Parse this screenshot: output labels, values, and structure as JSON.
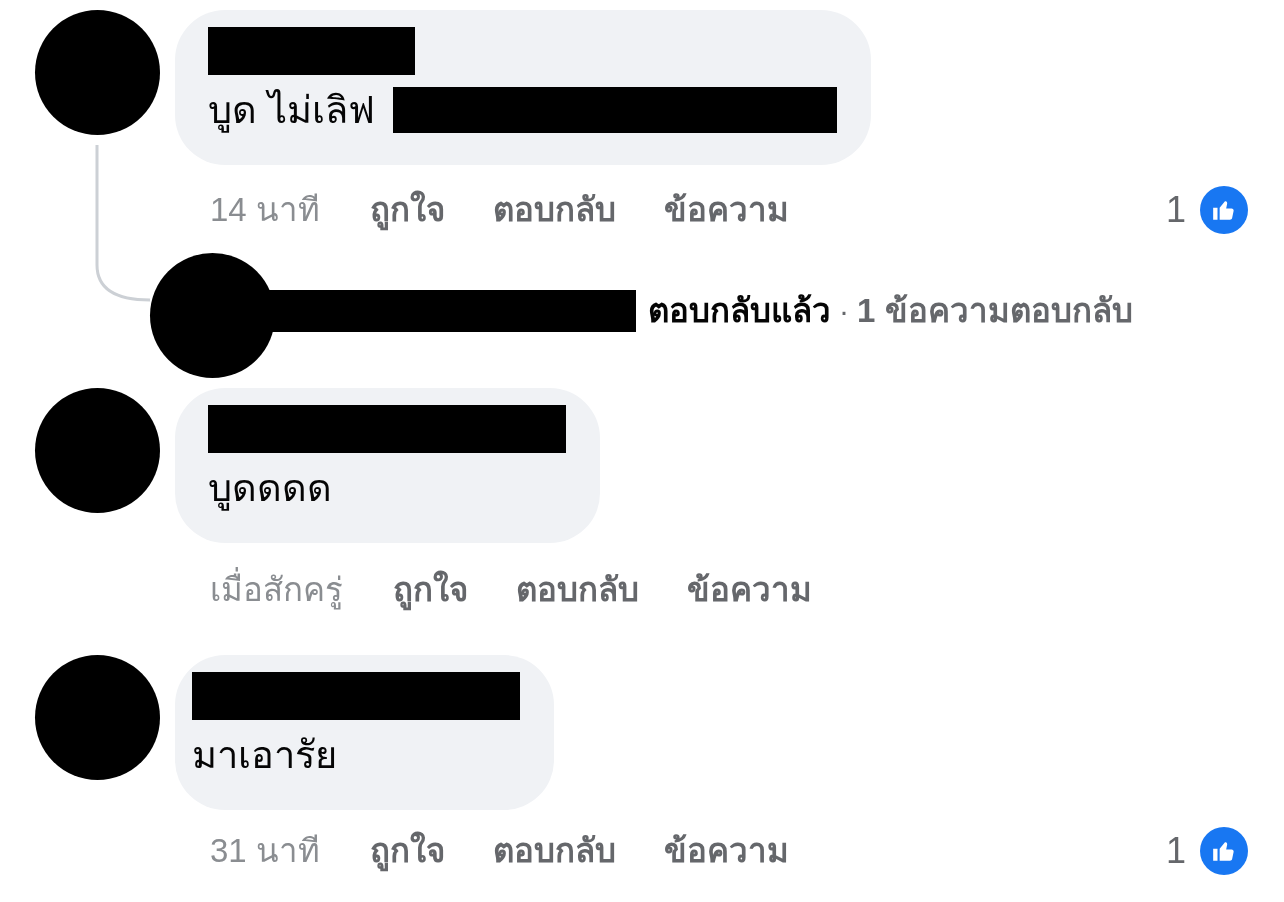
{
  "comments": [
    {
      "text": "บูด ไม่เลิฟ",
      "text_redacted_tail": true,
      "time": "14 นาที",
      "actions": [
        "ถูกใจ",
        "ตอบกลับ",
        "ข้อความ"
      ],
      "like_count": "1",
      "replies": {
        "status": "ตอบกลับแล้ว",
        "separator": "·",
        "count_text": "1 ข้อความตอบกลับ"
      }
    },
    {
      "text": "บูดดดด",
      "text_redacted_tail": false,
      "time": "เมื่อสักครู่",
      "actions": [
        "ถูกใจ",
        "ตอบกลับ",
        "ข้อความ"
      ]
    },
    {
      "text": "มาเอารัย",
      "text_redacted_tail": false,
      "time": "31 นาที",
      "actions": [
        "ถูกใจ",
        "ตอบกลับ",
        "ข้อความ"
      ],
      "like_count": "1"
    }
  ]
}
